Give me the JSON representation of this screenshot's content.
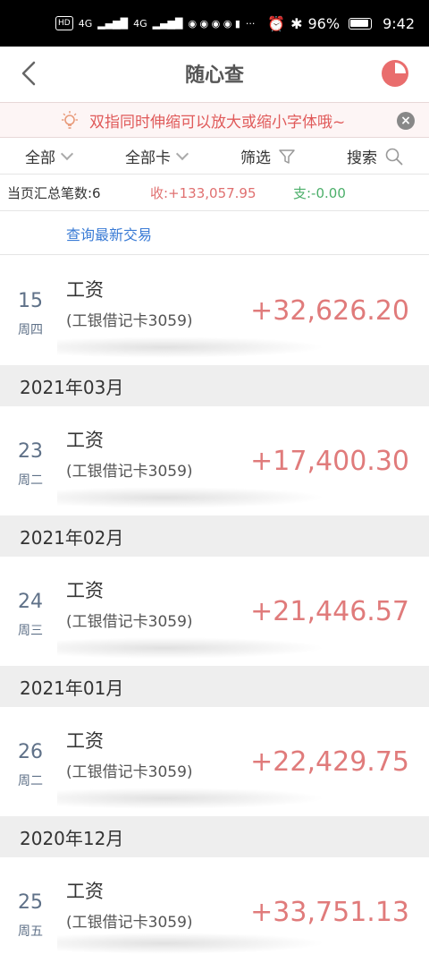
{
  "status_bar": {
    "network_labels": [
      "HD",
      "4G",
      "4G"
    ],
    "battery": "96%",
    "time": "9:42"
  },
  "nav": {
    "title": "随心查",
    "accent_color": "#e96d6d"
  },
  "tip": {
    "text": "双指同时伸缩可以放大或缩小字体哦~",
    "close_label": "×"
  },
  "filters": {
    "all_label": "全部",
    "card_label": "全部卡",
    "filter_label": "筛选",
    "search_label": "搜索"
  },
  "summary": {
    "count_text": "当页汇总笔数:6",
    "income_text": "收:+133,057.95",
    "expense_text": "支:-0.00"
  },
  "query_link": "查询最新交易",
  "transactions": [
    {
      "day": "15",
      "weekday": "周四",
      "title": "工资",
      "account": "(工银借记卡3059)",
      "amount": "+32,626.20"
    },
    {
      "day": "23",
      "weekday": "周二",
      "title": "工资",
      "account": "(工银借记卡3059)",
      "amount": "+17,400.30"
    },
    {
      "day": "24",
      "weekday": "周三",
      "title": "工资",
      "account": "(工银借记卡3059)",
      "amount": "+21,446.57"
    },
    {
      "day": "26",
      "weekday": "周二",
      "title": "工资",
      "account": "(工银借记卡3059)",
      "amount": "+22,429.75"
    },
    {
      "day": "25",
      "weekday": "周五",
      "title": "工资",
      "account": "(工银借记卡3059)",
      "amount": "+33,751.13"
    }
  ],
  "sections": [
    "2021年03月",
    "2021年02月",
    "2021年01月",
    "2020年12月"
  ]
}
